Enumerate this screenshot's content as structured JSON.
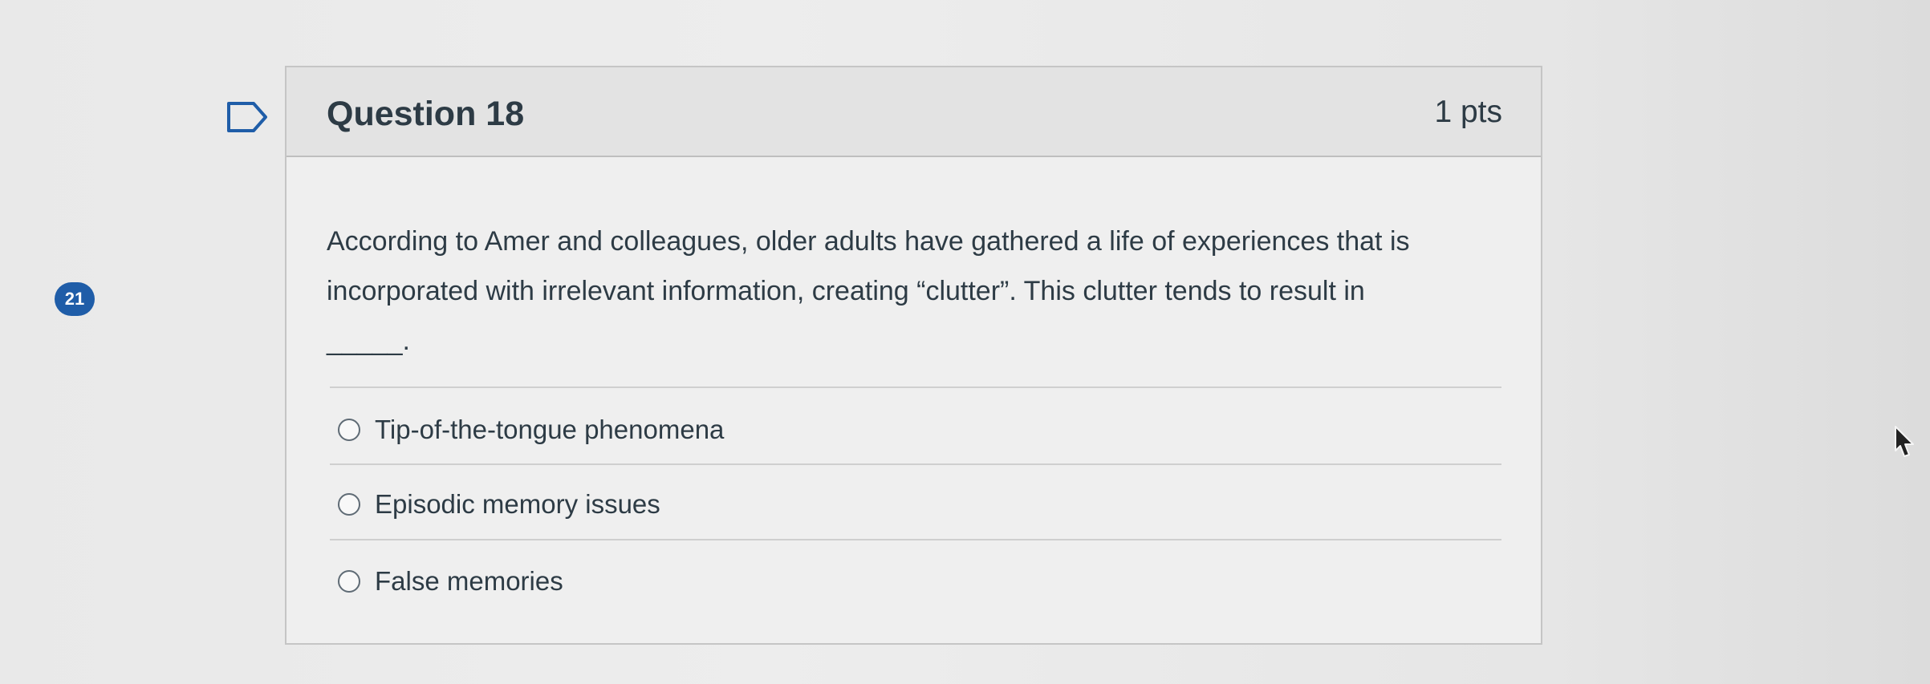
{
  "question_number_badge": "21",
  "question": {
    "title": "Question 18",
    "points": "1 pts",
    "text_lines": [
      "According to Amer and colleagues, older adults have gathered a life of experiences that is",
      "incorporated with irrelevant information, creating “clutter”. This clutter tends to result in",
      "_____."
    ],
    "answers": [
      {
        "label": "Tip-of-the-tongue phenomena",
        "selected": false
      },
      {
        "label": "Episodic memory issues",
        "selected": false
      },
      {
        "label": "False memories",
        "selected": false
      }
    ]
  },
  "icons": {
    "flag": "flag-icon",
    "cursor": "mouse-cursor-icon"
  },
  "colors": {
    "badge": "#1f5da8",
    "text": "#2d3b45",
    "header_background": "#e3e3e3",
    "card_background": "#efefef"
  }
}
